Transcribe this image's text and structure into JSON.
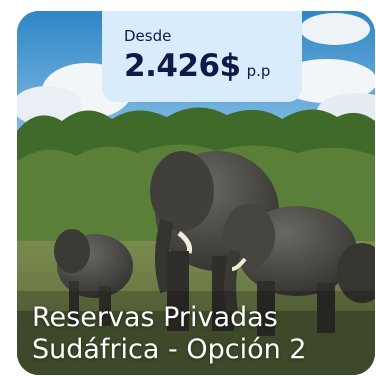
{
  "offer": {
    "price_prefix": "Desde",
    "price": "2.426$",
    "price_unit": "p.p",
    "title_line1": "Reservas Privadas",
    "title_line2": "Sudáfrica - Opción 2"
  },
  "colors": {
    "price_box_bg": "#d9ecfb",
    "price_text": "#0f1a49",
    "title_text": "#ffffff"
  },
  "icons": {
    "photo": "elephant-herd-photo"
  }
}
